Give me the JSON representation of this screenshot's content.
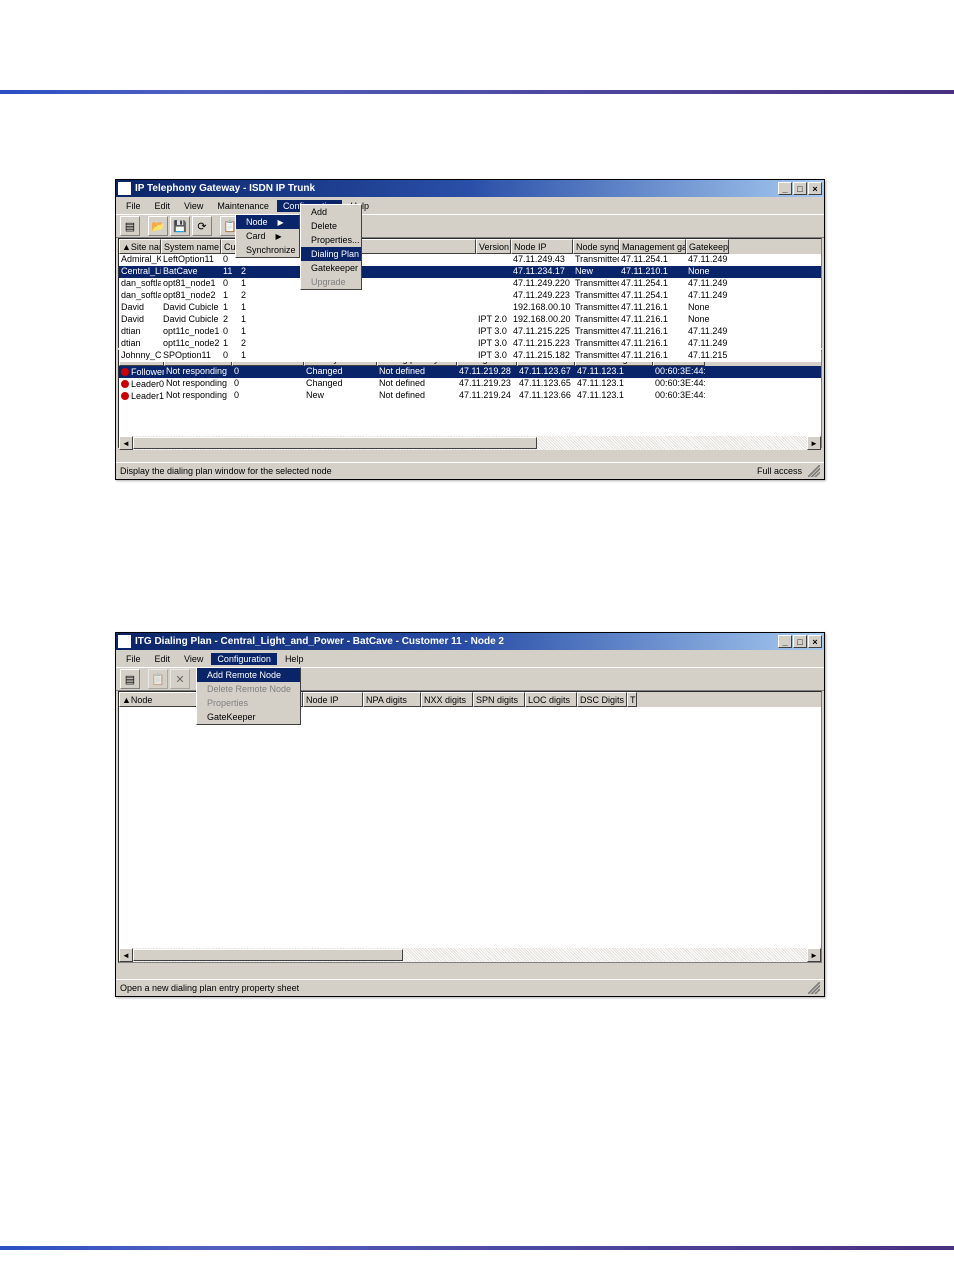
{
  "win1": {
    "title": "IP Telephony Gateway - ISDN IP Trunk",
    "menuItems": [
      "File",
      "Edit",
      "View",
      "Maintenance",
      "Configuration",
      "Help"
    ],
    "configMenu": {
      "items": [
        {
          "label": "Node",
          "arrow": true,
          "hi": true
        },
        {
          "label": "Card",
          "arrow": true
        },
        {
          "label": "Synchronize",
          "arrow": true
        }
      ],
      "sub": [
        {
          "label": "Add"
        },
        {
          "label": "Delete"
        },
        {
          "label": "Properties..."
        },
        {
          "label": "Dialing Plan",
          "hi": true
        },
        {
          "label": "Gatekeeper"
        },
        {
          "label": "Upgrade",
          "dis": true
        }
      ]
    },
    "upperCols": [
      "Site name",
      "System name",
      "Cu",
      "",
      "",
      "Version",
      "Node IP",
      "Node synch...",
      "Management gat...",
      "Gatekeepe"
    ],
    "upperRows": [
      {
        "c": [
          "Admiral_K…",
          "LeftOption11",
          "0",
          "",
          "",
          "",
          "47.11.249.43",
          "Transmitted",
          "47.11.254.1",
          "47.11.249"
        ]
      },
      {
        "sel": true,
        "c": [
          "Central_Li…",
          "BatCave",
          "11",
          "2",
          "",
          "",
          "47.11.234.17",
          "New",
          "47.11.210.1",
          "None"
        ]
      },
      {
        "c": [
          "dan_softla…",
          "opt81_node1",
          "0",
          "1",
          "",
          "",
          "47.11.249.220",
          "Transmitted",
          "47.11.254.1",
          "47.11.249"
        ]
      },
      {
        "c": [
          "dan_softla…",
          "opt81_node2",
          "1",
          "2",
          "",
          "",
          "47.11.249.223",
          "Transmitted",
          "47.11.254.1",
          "47.11.249"
        ]
      },
      {
        "c": [
          "David",
          "David Cubicle",
          "1",
          "1",
          "",
          "",
          "192.168.00.10",
          "Transmitted",
          "47.11.216.1",
          "None"
        ]
      },
      {
        "c": [
          "David",
          "David Cubicle",
          "2",
          "1",
          "",
          "IPT 2.0",
          "192.168.00.20",
          "Transmitted",
          "47.11.216.1",
          "None"
        ]
      },
      {
        "c": [
          "dtian",
          "opt11c_node1",
          "0",
          "1",
          "",
          "IPT 3.0",
          "47.11.215.225",
          "Transmitted",
          "47.11.216.1",
          "47.11.249"
        ]
      },
      {
        "c": [
          "dtian",
          "opt11c_node2",
          "1",
          "2",
          "",
          "IPT 3.0",
          "47.11.215.223",
          "Transmitted",
          "47.11.216.1",
          "47.11.249"
        ]
      },
      {
        "c": [
          "Johnny_C…",
          "SPOption11",
          "0",
          "1",
          "",
          "IPT 3.0",
          "47.11.215.182",
          "Transmitted",
          "47.11.216.1",
          "47.11.215"
        ]
      }
    ],
    "lowerCols": [
      "Card role",
      "Card state",
      "Nodes in fallback",
      "Card synch status",
      "Dialing plan synch…",
      "Management IP",
      "Voice IP",
      "Voice LAN gatew…",
      "MAC address"
    ],
    "lowerRows": [
      {
        "sel": true,
        "c": [
          "Follower",
          "Not responding",
          "0",
          "Changed",
          "Not defined",
          "47.11.219.28",
          "47.11.123.67",
          "47.11.123.1",
          "00:60:3E:44:"
        ]
      },
      {
        "c": [
          "Leader0",
          "Not responding",
          "0",
          "Changed",
          "Not defined",
          "47.11.219.23",
          "47.11.123.65",
          "47.11.123.1",
          "00:60:3E:44:"
        ]
      },
      {
        "c": [
          "Leader1",
          "Not responding",
          "0",
          "New",
          "Not defined",
          "47.11.219.24",
          "47.11.123.66",
          "47.11.123.1",
          "00:60:3E:44:"
        ]
      }
    ],
    "statusLeft": "Display the dialing plan window for the selected node",
    "statusRight": "Full access"
  },
  "win2": {
    "title": "ITG Dialing Plan - Central_Light_and_Power - BatCave - Customer 11 - Node 2",
    "menuItems": [
      "File",
      "Edit",
      "View",
      "Configuration",
      "Help"
    ],
    "configMenu": {
      "items": [
        {
          "label": "Add Remote Node",
          "hi": true
        },
        {
          "label": "Delete Remote Node",
          "dis": true
        },
        {
          "label": "Properties",
          "dis": true
        },
        {
          "label": "GateKeeper"
        }
      ]
    },
    "cols": [
      "Node",
      "Node IP",
      "NPA digits",
      "NXX digits",
      "SPN digits",
      "LOC digits",
      "DSC Digits",
      "T"
    ],
    "statusLeft": "Open a new dialing plan entry property sheet"
  },
  "ctl": {
    "min": "_",
    "max": "□",
    "close": "×"
  },
  "arrows": {
    "l": "◄",
    "r": "►",
    "u": "▲"
  }
}
